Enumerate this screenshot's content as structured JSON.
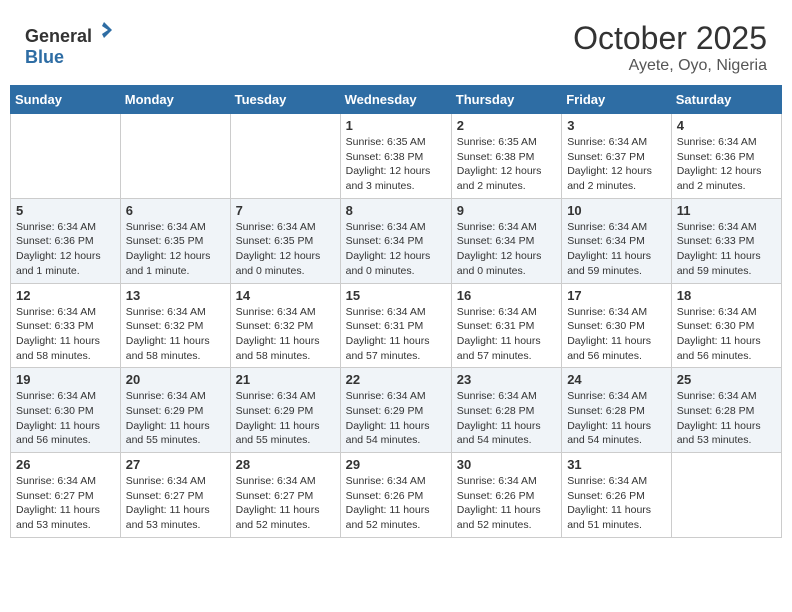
{
  "header": {
    "logo_general": "General",
    "logo_blue": "Blue",
    "month": "October 2025",
    "location": "Ayete, Oyo, Nigeria"
  },
  "days_of_week": [
    "Sunday",
    "Monday",
    "Tuesday",
    "Wednesday",
    "Thursday",
    "Friday",
    "Saturday"
  ],
  "weeks": [
    [
      {
        "day": "",
        "info": ""
      },
      {
        "day": "",
        "info": ""
      },
      {
        "day": "",
        "info": ""
      },
      {
        "day": "1",
        "info": "Sunrise: 6:35 AM\nSunset: 6:38 PM\nDaylight: 12 hours and 3 minutes."
      },
      {
        "day": "2",
        "info": "Sunrise: 6:35 AM\nSunset: 6:38 PM\nDaylight: 12 hours and 2 minutes."
      },
      {
        "day": "3",
        "info": "Sunrise: 6:34 AM\nSunset: 6:37 PM\nDaylight: 12 hours and 2 minutes."
      },
      {
        "day": "4",
        "info": "Sunrise: 6:34 AM\nSunset: 6:36 PM\nDaylight: 12 hours and 2 minutes."
      }
    ],
    [
      {
        "day": "5",
        "info": "Sunrise: 6:34 AM\nSunset: 6:36 PM\nDaylight: 12 hours and 1 minute."
      },
      {
        "day": "6",
        "info": "Sunrise: 6:34 AM\nSunset: 6:35 PM\nDaylight: 12 hours and 1 minute."
      },
      {
        "day": "7",
        "info": "Sunrise: 6:34 AM\nSunset: 6:35 PM\nDaylight: 12 hours and 0 minutes."
      },
      {
        "day": "8",
        "info": "Sunrise: 6:34 AM\nSunset: 6:34 PM\nDaylight: 12 hours and 0 minutes."
      },
      {
        "day": "9",
        "info": "Sunrise: 6:34 AM\nSunset: 6:34 PM\nDaylight: 12 hours and 0 minutes."
      },
      {
        "day": "10",
        "info": "Sunrise: 6:34 AM\nSunset: 6:34 PM\nDaylight: 11 hours and 59 minutes."
      },
      {
        "day": "11",
        "info": "Sunrise: 6:34 AM\nSunset: 6:33 PM\nDaylight: 11 hours and 59 minutes."
      }
    ],
    [
      {
        "day": "12",
        "info": "Sunrise: 6:34 AM\nSunset: 6:33 PM\nDaylight: 11 hours and 58 minutes."
      },
      {
        "day": "13",
        "info": "Sunrise: 6:34 AM\nSunset: 6:32 PM\nDaylight: 11 hours and 58 minutes."
      },
      {
        "day": "14",
        "info": "Sunrise: 6:34 AM\nSunset: 6:32 PM\nDaylight: 11 hours and 58 minutes."
      },
      {
        "day": "15",
        "info": "Sunrise: 6:34 AM\nSunset: 6:31 PM\nDaylight: 11 hours and 57 minutes."
      },
      {
        "day": "16",
        "info": "Sunrise: 6:34 AM\nSunset: 6:31 PM\nDaylight: 11 hours and 57 minutes."
      },
      {
        "day": "17",
        "info": "Sunrise: 6:34 AM\nSunset: 6:30 PM\nDaylight: 11 hours and 56 minutes."
      },
      {
        "day": "18",
        "info": "Sunrise: 6:34 AM\nSunset: 6:30 PM\nDaylight: 11 hours and 56 minutes."
      }
    ],
    [
      {
        "day": "19",
        "info": "Sunrise: 6:34 AM\nSunset: 6:30 PM\nDaylight: 11 hours and 56 minutes."
      },
      {
        "day": "20",
        "info": "Sunrise: 6:34 AM\nSunset: 6:29 PM\nDaylight: 11 hours and 55 minutes."
      },
      {
        "day": "21",
        "info": "Sunrise: 6:34 AM\nSunset: 6:29 PM\nDaylight: 11 hours and 55 minutes."
      },
      {
        "day": "22",
        "info": "Sunrise: 6:34 AM\nSunset: 6:29 PM\nDaylight: 11 hours and 54 minutes."
      },
      {
        "day": "23",
        "info": "Sunrise: 6:34 AM\nSunset: 6:28 PM\nDaylight: 11 hours and 54 minutes."
      },
      {
        "day": "24",
        "info": "Sunrise: 6:34 AM\nSunset: 6:28 PM\nDaylight: 11 hours and 54 minutes."
      },
      {
        "day": "25",
        "info": "Sunrise: 6:34 AM\nSunset: 6:28 PM\nDaylight: 11 hours and 53 minutes."
      }
    ],
    [
      {
        "day": "26",
        "info": "Sunrise: 6:34 AM\nSunset: 6:27 PM\nDaylight: 11 hours and 53 minutes."
      },
      {
        "day": "27",
        "info": "Sunrise: 6:34 AM\nSunset: 6:27 PM\nDaylight: 11 hours and 53 minutes."
      },
      {
        "day": "28",
        "info": "Sunrise: 6:34 AM\nSunset: 6:27 PM\nDaylight: 11 hours and 52 minutes."
      },
      {
        "day": "29",
        "info": "Sunrise: 6:34 AM\nSunset: 6:26 PM\nDaylight: 11 hours and 52 minutes."
      },
      {
        "day": "30",
        "info": "Sunrise: 6:34 AM\nSunset: 6:26 PM\nDaylight: 11 hours and 52 minutes."
      },
      {
        "day": "31",
        "info": "Sunrise: 6:34 AM\nSunset: 6:26 PM\nDaylight: 11 hours and 51 minutes."
      },
      {
        "day": "",
        "info": ""
      }
    ]
  ]
}
